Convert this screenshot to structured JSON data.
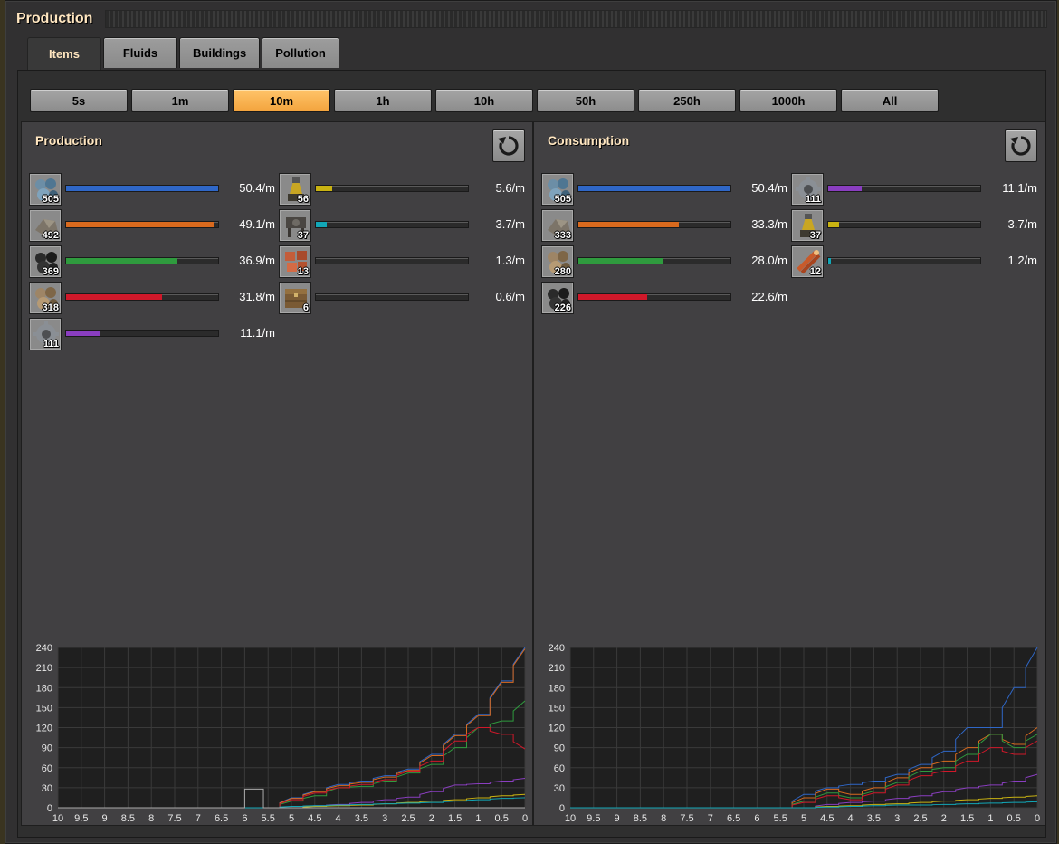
{
  "window": {
    "title": "Production"
  },
  "tabs": [
    {
      "label": "Items",
      "active": true
    },
    {
      "label": "Fluids",
      "active": false
    },
    {
      "label": "Buildings",
      "active": false
    },
    {
      "label": "Pollution",
      "active": false
    }
  ],
  "time_buttons": [
    {
      "label": "5s",
      "active": false
    },
    {
      "label": "1m",
      "active": false
    },
    {
      "label": "10m",
      "active": true
    },
    {
      "label": "1h",
      "active": false
    },
    {
      "label": "10h",
      "active": false
    },
    {
      "label": "50h",
      "active": false
    },
    {
      "label": "250h",
      "active": false
    },
    {
      "label": "1000h",
      "active": false
    },
    {
      "label": "All",
      "active": false
    }
  ],
  "colors": {
    "blue": "#2f67c7",
    "orange": "#d96a1e",
    "green": "#2f9b3e",
    "red": "#d0182a",
    "purple": "#8a3ec0",
    "yellow": "#c9b312",
    "teal": "#12a7b7"
  },
  "production": {
    "title": "Production",
    "reset_icon": "reset-icon",
    "items": [
      {
        "icon": "iron-ore-icon",
        "count": "505",
        "rate": "50.4/m",
        "fill": 1.0,
        "color": "#2f67c7"
      },
      {
        "icon": "stone-icon",
        "count": "492",
        "rate": "49.1/m",
        "fill": 0.97,
        "color": "#d96a1e"
      },
      {
        "icon": "coal-icon",
        "count": "369",
        "rate": "36.9/m",
        "fill": 0.73,
        "color": "#2f9b3e"
      },
      {
        "icon": "copper-ore-icon",
        "count": "318",
        "rate": "31.8/m",
        "fill": 0.63,
        "color": "#d0182a"
      },
      {
        "icon": "iron-gear-icon",
        "count": "111",
        "rate": "11.1/m",
        "fill": 0.22,
        "color": "#8a3ec0"
      },
      {
        "icon": "burner-inserter-icon",
        "count": "56",
        "rate": "5.6/m",
        "fill": 0.11,
        "color": "#c9b312"
      },
      {
        "icon": "burner-mining-drill-icon",
        "count": "37",
        "rate": "3.7/m",
        "fill": 0.07,
        "color": "#12a7b7"
      },
      {
        "icon": "copper-plate-icon",
        "count": "13",
        "rate": "1.3/m",
        "fill": 0.0,
        "color": "#999999"
      },
      {
        "icon": "wooden-chest-icon",
        "count": "6",
        "rate": "0.6/m",
        "fill": 0.0,
        "color": "#999999"
      }
    ]
  },
  "consumption": {
    "title": "Consumption",
    "reset_icon": "reset-icon",
    "items": [
      {
        "icon": "iron-ore-icon",
        "count": "505",
        "rate": "50.4/m",
        "fill": 1.0,
        "color": "#2f67c7"
      },
      {
        "icon": "stone-icon",
        "count": "333",
        "rate": "33.3/m",
        "fill": 0.66,
        "color": "#d96a1e"
      },
      {
        "icon": "copper-ore-icon",
        "count": "280",
        "rate": "28.0/m",
        "fill": 0.56,
        "color": "#2f9b3e"
      },
      {
        "icon": "coal-icon",
        "count": "226",
        "rate": "22.6/m",
        "fill": 0.45,
        "color": "#d0182a"
      },
      {
        "icon": "iron-gear-icon",
        "count": "111",
        "rate": "11.1/m",
        "fill": 0.22,
        "color": "#8a3ec0"
      },
      {
        "icon": "burner-inserter-icon",
        "count": "37",
        "rate": "3.7/m",
        "fill": 0.07,
        "color": "#c9b312"
      },
      {
        "icon": "copper-cable-icon",
        "count": "12",
        "rate": "1.2/m",
        "fill": 0.02,
        "color": "#12a7b7"
      }
    ]
  },
  "chart_data": [
    {
      "type": "line",
      "y_ticks": [
        "240",
        "210",
        "180",
        "150",
        "120",
        "90",
        "60",
        "30",
        "0"
      ],
      "x_ticks": [
        "10",
        "9.5",
        "9",
        "8.5",
        "8",
        "7.5",
        "7",
        "6.5",
        "6",
        "5.5",
        "5",
        "4.5",
        "4",
        "3.5",
        "3",
        "2.5",
        "2",
        "1.5",
        "1",
        "0.5",
        "0"
      ],
      "ylim": [
        0,
        240
      ],
      "xlim": [
        10,
        0
      ],
      "grid": true,
      "series": [
        {
          "color": "#2f67c7",
          "x": [
            10,
            5.5,
            5,
            4.5,
            4,
            3.5,
            3,
            2.5,
            2,
            1.5,
            1,
            0.5,
            0
          ],
          "y": [
            0,
            0,
            15,
            25,
            35,
            40,
            48,
            58,
            80,
            110,
            140,
            190,
            240
          ]
        },
        {
          "color": "#d96a1e",
          "x": [
            10,
            5.5,
            5,
            4.5,
            4,
            3.5,
            3,
            2.5,
            2,
            1.5,
            1,
            0.5,
            0
          ],
          "y": [
            0,
            0,
            14,
            24,
            33,
            38,
            46,
            56,
            78,
            108,
            138,
            188,
            238
          ]
        },
        {
          "color": "#2f9b3e",
          "x": [
            10,
            5.5,
            5,
            4.5,
            4,
            3.5,
            3,
            2.5,
            2,
            1.5,
            1,
            0.5,
            0
          ],
          "y": [
            0,
            0,
            10,
            18,
            30,
            32,
            40,
            52,
            65,
            90,
            120,
            130,
            160
          ]
        },
        {
          "color": "#d0182a",
          "x": [
            10,
            5.5,
            5,
            4.5,
            4,
            3.5,
            3,
            2.5,
            2,
            1.5,
            1,
            0.5,
            0
          ],
          "y": [
            0,
            0,
            12,
            22,
            30,
            35,
            42,
            55,
            70,
            100,
            120,
            110,
            88
          ]
        },
        {
          "color": "#8a3ec0",
          "x": [
            10,
            5.5,
            5,
            4.5,
            4,
            3.5,
            3,
            2.5,
            2,
            1.5,
            1,
            0.5,
            0
          ],
          "y": [
            0,
            0,
            0,
            3,
            5,
            8,
            12,
            16,
            24,
            34,
            36,
            40,
            44
          ]
        },
        {
          "color": "#c9b312",
          "x": [
            10,
            5.5,
            5,
            4.5,
            4,
            3.5,
            3,
            2.5,
            2,
            1.5,
            1,
            0.5,
            0
          ],
          "y": [
            0,
            0,
            0,
            2,
            3,
            4,
            6,
            8,
            10,
            12,
            15,
            18,
            20
          ]
        },
        {
          "color": "#12a7b7",
          "x": [
            10,
            5.5,
            5,
            4.5,
            4,
            3.5,
            3,
            2.5,
            2,
            1.5,
            1,
            0.5,
            0
          ],
          "y": [
            0,
            0,
            2,
            3,
            4,
            5,
            6,
            7,
            8,
            10,
            12,
            14,
            15
          ]
        },
        {
          "color": "#aaaaaa",
          "x": [
            10,
            6,
            6,
            5.6,
            5.6,
            5.5,
            0
          ],
          "y": [
            0,
            0,
            28,
            28,
            0,
            0,
            0
          ]
        }
      ]
    },
    {
      "type": "line",
      "y_ticks": [
        "240",
        "210",
        "180",
        "150",
        "120",
        "90",
        "60",
        "30",
        "0"
      ],
      "x_ticks": [
        "10",
        "9.5",
        "9",
        "8.5",
        "8",
        "7.5",
        "7",
        "6.5",
        "6",
        "5.5",
        "5",
        "4.5",
        "4",
        "3.5",
        "3",
        "2.5",
        "2",
        "1.5",
        "1",
        "0.5",
        "0"
      ],
      "ylim": [
        0,
        240
      ],
      "xlim": [
        10,
        0
      ],
      "grid": true,
      "series": [
        {
          "color": "#2f67c7",
          "x": [
            10,
            5.5,
            5,
            4.5,
            4,
            3.5,
            3,
            2.5,
            2,
            1.5,
            1,
            0.5,
            0
          ],
          "y": [
            0,
            0,
            20,
            30,
            35,
            40,
            50,
            65,
            85,
            120,
            120,
            180,
            240
          ]
        },
        {
          "color": "#d96a1e",
          "x": [
            10,
            5.5,
            5,
            4.5,
            4,
            3.5,
            3,
            2.5,
            2,
            1.5,
            1,
            0.5,
            0
          ],
          "y": [
            0,
            0,
            15,
            28,
            20,
            30,
            45,
            60,
            70,
            90,
            110,
            95,
            120
          ]
        },
        {
          "color": "#2f9b3e",
          "x": [
            10,
            5.5,
            5,
            4.5,
            4,
            3.5,
            3,
            2.5,
            2,
            1.5,
            1,
            0.5,
            0
          ],
          "y": [
            0,
            0,
            10,
            22,
            15,
            25,
            38,
            55,
            60,
            80,
            110,
            90,
            110
          ]
        },
        {
          "color": "#d0182a",
          "x": [
            10,
            5.5,
            5,
            4.5,
            4,
            3.5,
            3,
            2.5,
            2,
            1.5,
            1,
            0.5,
            0
          ],
          "y": [
            0,
            0,
            8,
            18,
            12,
            22,
            34,
            48,
            55,
            70,
            90,
            80,
            100
          ]
        },
        {
          "color": "#8a3ec0",
          "x": [
            10,
            5.5,
            5,
            4.5,
            4,
            3.5,
            3,
            2.5,
            2,
            1.5,
            1,
            0.5,
            0
          ],
          "y": [
            0,
            0,
            0,
            5,
            8,
            10,
            14,
            18,
            24,
            30,
            34,
            40,
            50
          ]
        },
        {
          "color": "#c9b312",
          "x": [
            10,
            5.5,
            5,
            4.5,
            4,
            3.5,
            3,
            2.5,
            2,
            1.5,
            1,
            0.5,
            0
          ],
          "y": [
            0,
            0,
            0,
            2,
            3,
            5,
            6,
            8,
            10,
            12,
            14,
            16,
            18
          ]
        },
        {
          "color": "#12a7b7",
          "x": [
            10,
            5.5,
            5,
            4.5,
            4,
            3.5,
            3,
            2.5,
            2,
            1.5,
            1,
            0.5,
            0
          ],
          "y": [
            0,
            0,
            0,
            1,
            2,
            3,
            4,
            4,
            5,
            6,
            7,
            8,
            9
          ]
        }
      ]
    }
  ]
}
